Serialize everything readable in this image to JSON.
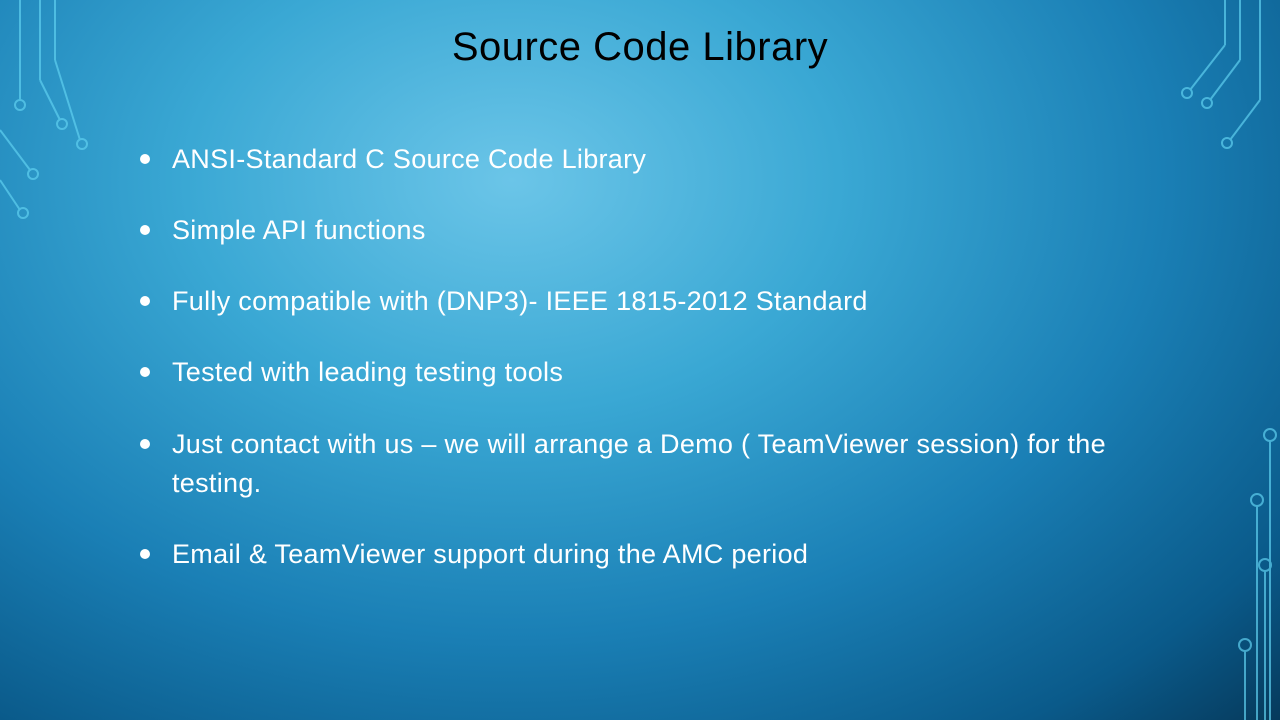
{
  "title": "Source Code Library",
  "bullets": [
    "ANSI-Standard C Source Code Library",
    "Simple API functions",
    "Fully compatible with (DNP3)- IEEE 1815-2012 Standard",
    "Tested with leading testing tools",
    "Just contact with us – we will arrange a Demo ( TeamViewer session) for the testing.",
    "Email & TeamViewer support during the AMC period"
  ]
}
